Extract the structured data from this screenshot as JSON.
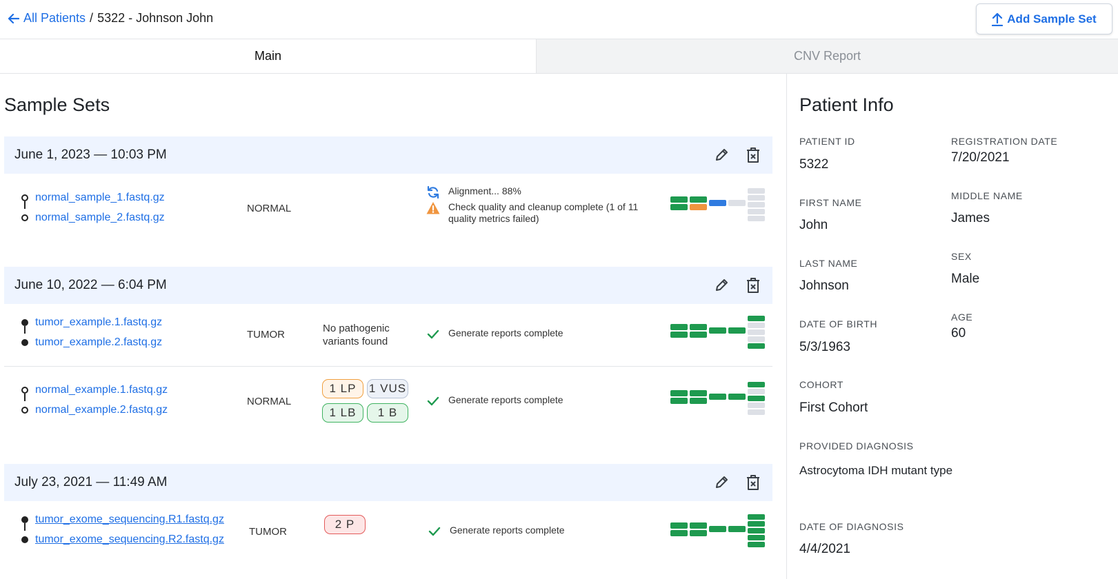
{
  "header": {
    "back_label": "All Patients",
    "separator": "/",
    "current": "5322 - Johnson John",
    "add_button": "Add Sample Set"
  },
  "tabs": [
    {
      "label": "Main",
      "active": true
    },
    {
      "label": "CNV Report",
      "active": false
    }
  ],
  "sample_sets_title": "Sample Sets",
  "sample_sets": [
    {
      "date": "June 1, 2023 — 10:03 PM",
      "rows": [
        {
          "files": [
            "normal_sample_1.fastq.gz",
            "normal_sample_2.fastq.gz"
          ],
          "type": "NORMAL",
          "statuses": [
            {
              "icon": "sync-icon",
              "text": "Alignment... 88%"
            },
            {
              "icon": "warning-icon",
              "text": "Check quality and cleanup complete (1 of 11 quality metrics failed)"
            }
          ]
        }
      ]
    },
    {
      "date": "June 10, 2022 — 6:04 PM",
      "rows": [
        {
          "files": [
            "tumor_example.1.fastq.gz",
            "tumor_example.2.fastq.gz"
          ],
          "type": "TUMOR",
          "variants_text": "No pathogenic variants found",
          "statuses": [
            {
              "icon": "check-icon",
              "text": "Generate reports complete"
            }
          ]
        },
        {
          "files": [
            "normal_example.1.fastq.gz",
            "normal_example.2.fastq.gz"
          ],
          "type": "NORMAL",
          "variant_chips": [
            "1 LP",
            "1 VUS",
            "1 LB",
            "1 B"
          ],
          "statuses": [
            {
              "icon": "check-icon",
              "text": "Generate reports complete"
            }
          ]
        }
      ]
    },
    {
      "date": "July 23, 2021 — 11:49 AM",
      "rows": [
        {
          "files": [
            "tumor_exome_sequencing.R1.fastq.gz",
            "tumor_exome_sequencing.R2.fastq.gz"
          ],
          "type": "TUMOR",
          "variant_chips": [
            "2 P"
          ],
          "statuses": [
            {
              "icon": "check-icon",
              "text": "Generate reports complete"
            }
          ]
        }
      ]
    }
  ],
  "patient_info": {
    "title": "Patient Info",
    "fields": {
      "patient_id": {
        "label": "PATIENT ID",
        "value": "5322"
      },
      "registration_date": {
        "label": "REGISTRATION DATE",
        "value": "7/20/2021"
      },
      "first_name": {
        "label": "FIRST NAME",
        "value": "John"
      },
      "middle_name": {
        "label": "MIDDLE NAME",
        "value": "James"
      },
      "last_name": {
        "label": "LAST NAME",
        "value": "Johnson"
      },
      "sex": {
        "label": "SEX",
        "value": "Male"
      },
      "date_of_birth": {
        "label": "DATE OF BIRTH",
        "value": "5/3/1963"
      },
      "age": {
        "label": "AGE",
        "value": "60"
      },
      "cohort": {
        "label": "COHORT",
        "value": "First Cohort"
      },
      "provided_diagnosis": {
        "label": "PROVIDED DIAGNOSIS",
        "value": "Astrocytoma IDH mutant type"
      },
      "date_of_diagnosis": {
        "label": "DATE OF DIAGNOSIS",
        "value": "4/4/2021"
      }
    }
  },
  "colors": {
    "link": "#1f6fe5",
    "step_done": "#1e9a4f",
    "step_warn": "#f0953f",
    "step_running": "#2f7be0",
    "step_pending": "#dde0e6",
    "header_band": "#eef4ff"
  }
}
